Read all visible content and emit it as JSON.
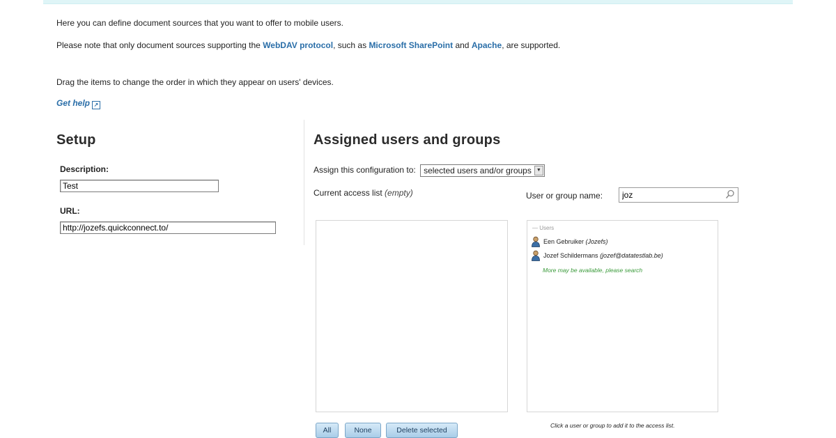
{
  "intro": {
    "line1": "Here you can define document sources that you want to offer to mobile users.",
    "line2_pre": "Please note that only document sources supporting the ",
    "link_webdav": "WebDAV protocol",
    "line2_mid": ", such as ",
    "link_sharepoint": "Microsoft SharePoint",
    "line2_and": " and ",
    "link_apache": "Apache",
    "line2_post": ", are supported.",
    "line3": "Drag the items to change the order in which they appear on users' devices.",
    "get_help": "Get help"
  },
  "setup": {
    "title": "Setup",
    "description_label": "Description:",
    "description_value": "Test",
    "url_label": "URL:",
    "url_value": "http://jozefs.quickconnect.to/"
  },
  "assigned": {
    "title": "Assigned users and groups",
    "assign_label": "Assign this configuration to:",
    "assign_selected": "selected users and/or groups",
    "access_label": "Current access list",
    "access_state": "(empty)",
    "search_label": "User or group name:",
    "search_value": "joz",
    "results_group": "— Users",
    "results": [
      {
        "name": "Een Gebruiker",
        "detail": "(Jozefs)"
      },
      {
        "name": "Jozef Schildermans",
        "detail": "(jozef@datatestlab.be)"
      }
    ],
    "more_text": "More may be available, please search",
    "hint": "Click a user or group to add it to the access list."
  },
  "buttons": {
    "all": "All",
    "none": "None",
    "delete_selected": "Delete selected"
  }
}
